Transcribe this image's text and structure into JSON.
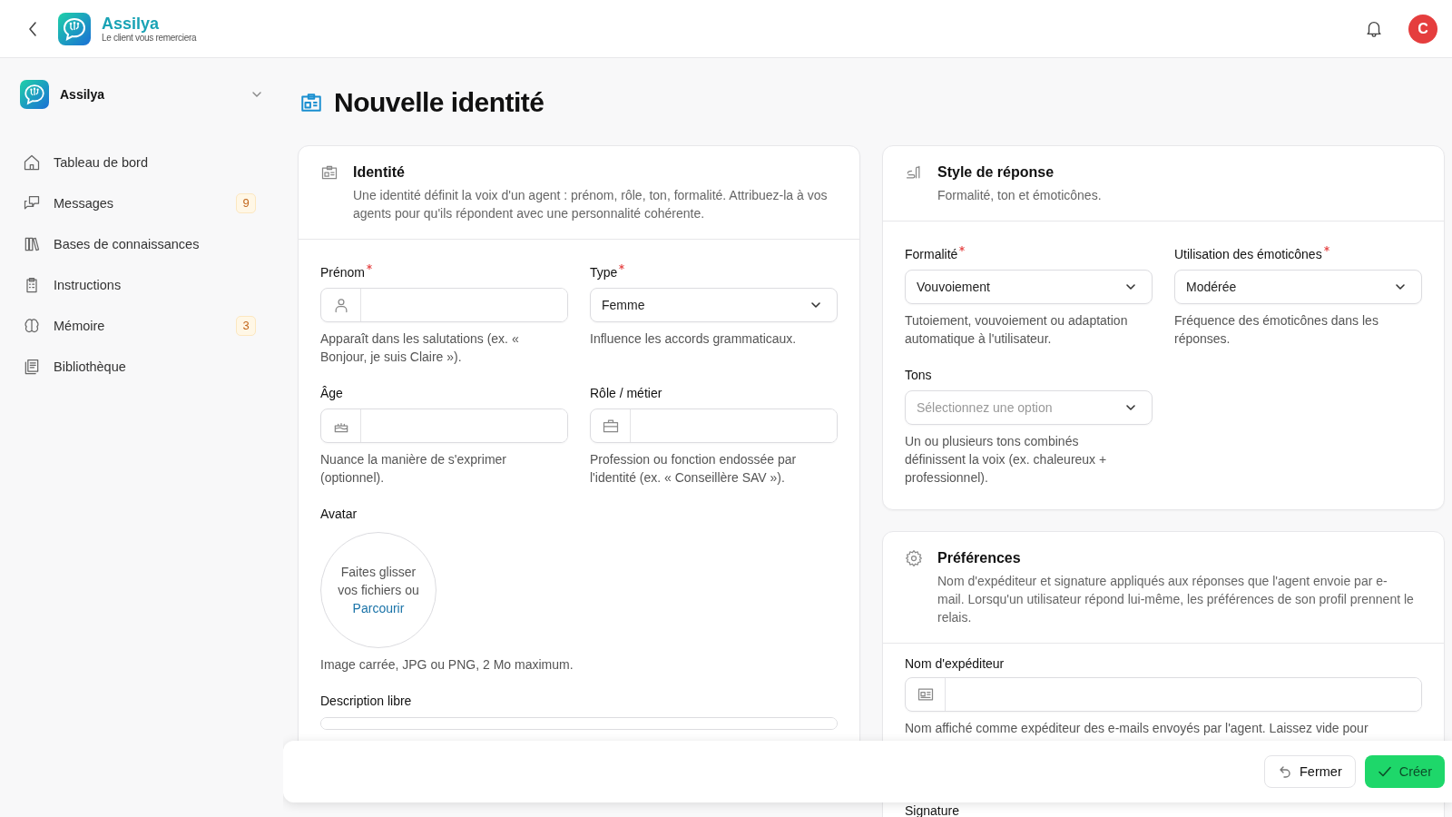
{
  "header": {
    "brand_name": "Assilya",
    "tagline": "Le client vous remerciera",
    "avatar_initial": "C"
  },
  "sidebar": {
    "workspace": "Assilya",
    "items": [
      {
        "label": "Tableau de bord",
        "selected": false
      },
      {
        "label": "Messages",
        "badge": "9",
        "selected": false
      },
      {
        "label": "Bases de connaissances",
        "selected": false
      },
      {
        "label": "Instructions",
        "selected": false
      },
      {
        "label": "Mémoire",
        "badge": "3",
        "selected": false
      },
      {
        "label": "Bibliothèque",
        "selected": false
      }
    ]
  },
  "page_title": "Nouvelle identité",
  "identity": {
    "title": "Identité",
    "description": "Une identité définit la voix d'un agent : prénom, rôle, ton, formalité. Attribuez-la à vos agents pour qu'ils répondent avec une personnalité cohérente.",
    "fields": [
      {
        "kind": "input",
        "label": "Prénom",
        "required": true,
        "help": "Apparaît dans les salutations (ex. « Bonjour, je suis Claire »)."
      },
      {
        "kind": "select",
        "label": "Type",
        "required": true,
        "value": "Femme",
        "help": "Influence les accords grammaticaux."
      },
      {
        "kind": "input",
        "label": "Âge",
        "required": false,
        "help": "Nuance la manière de s'exprimer (optionnel)."
      },
      {
        "kind": "input",
        "label": "Rôle / métier",
        "required": false,
        "help": "Profession ou fonction endossée par l'identité (ex. « Conseillère SAV »)."
      },
      {
        "kind": "avatar",
        "label": "Avatar",
        "prompt": "Faites glisser vos fichiers ou",
        "link": "Parcourir",
        "help": "Image carrée, JPG ou PNG, 2 Mo maximum."
      },
      {
        "kind": "textarea",
        "label": "Description libre"
      }
    ]
  },
  "style": {
    "title": "Style de réponse",
    "description": "Formalité, ton et émoticônes.",
    "fields": [
      {
        "kind": "select",
        "label": "Formalité",
        "required": true,
        "value": "Vouvoiement",
        "help": "Tutoiement, vouvoiement ou adaptation automatique à l'utilisateur."
      },
      {
        "kind": "select",
        "label": "Utilisation des émoticônes",
        "required": true,
        "value": "Modérée",
        "help": "Fréquence des émoticônes dans les réponses."
      },
      {
        "kind": "select",
        "label": "Tons",
        "required": false,
        "placeholder": "Sélectionnez une option",
        "help": "Un ou plusieurs tons combinés définissent la voix (ex. chaleureux + professionnel)."
      }
    ]
  },
  "preferences": {
    "title": "Préférences",
    "description": "Nom d'expéditeur et signature appliqués aux réponses que l'agent envoie par e-mail. Lorsqu'un utilisateur répond lui-même, les préférences de son profil prennent le relais.",
    "fields": [
      {
        "kind": "input",
        "label": "Nom d'expéditeur",
        "required": false,
        "help": "Nom affiché comme expéditeur des e-mails envoyés par l'agent. Laissez vide pour"
      },
      {
        "kind": "label",
        "label": "Signature"
      }
    ]
  },
  "footer": {
    "buttons": [
      {
        "kind": "secondary",
        "label": "Fermer"
      },
      {
        "kind": "primary",
        "label": "Créer"
      }
    ]
  }
}
